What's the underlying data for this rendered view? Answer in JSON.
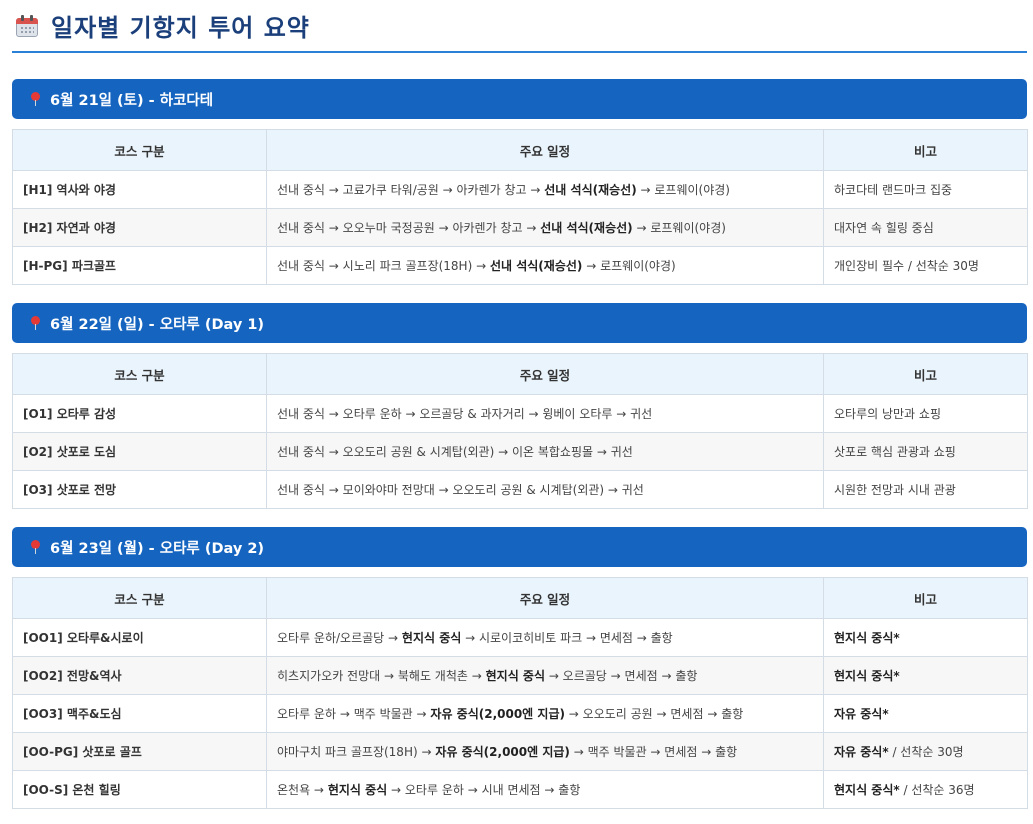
{
  "page": {
    "title": "일자별 기항지 투어 요약",
    "icon": "calendar-icon"
  },
  "columns": [
    "코스 구분",
    "주요 일정",
    "비고"
  ],
  "sections": [
    {
      "header": "6월 21일 (토) - 하코다테",
      "rows": [
        {
          "course": "[H1] 역사와 야경",
          "pre": "선내 중식 → 고료가쿠 타워/공원 → 아카렌가 창고 → ",
          "bold": "선내 석식(재승선)",
          "post": " → 로프웨이(야경)",
          "note_bold": "",
          "note": "하코다테 랜드마크 집중"
        },
        {
          "course": "[H2] 자연과 야경",
          "pre": "선내 중식 → 오오누마 국정공원 → 아카렌가 창고 → ",
          "bold": "선내 석식(재승선)",
          "post": " → 로프웨이(야경)",
          "note_bold": "",
          "note": "대자연 속 힐링 중심"
        },
        {
          "course": "[H-PG] 파크골프",
          "pre": "선내 중식 → 시노리 파크 골프장(18H) → ",
          "bold": "선내 석식(재승선)",
          "post": " → 로프웨이(야경)",
          "note_bold": "",
          "note": "개인장비 필수 / 선착순 30명"
        }
      ]
    },
    {
      "header": "6월 22일 (일) - 오타루 (Day 1)",
      "rows": [
        {
          "course": "[O1] 오타루 감성",
          "pre": "선내 중식 → 오타루 운하 → 오르골당 & 과자거리 → 윙베이 오타루 → 귀선",
          "bold": "",
          "post": "",
          "note_bold": "",
          "note": "오타루의 낭만과 쇼핑"
        },
        {
          "course": "[O2] 삿포로 도심",
          "pre": "선내 중식 → 오오도리 공원 & 시계탑(외관) → 이온 복합쇼핑몰 → 귀선",
          "bold": "",
          "post": "",
          "note_bold": "",
          "note": "삿포로 핵심 관광과 쇼핑"
        },
        {
          "course": "[O3] 삿포로 전망",
          "pre": "선내 중식 → 모이와야마 전망대 → 오오도리 공원 & 시계탑(외관) → 귀선",
          "bold": "",
          "post": "",
          "note_bold": "",
          "note": "시원한 전망과 시내 관광"
        }
      ]
    },
    {
      "header": "6월 23일 (월) - 오타루 (Day 2)",
      "rows": [
        {
          "course": "[OO1] 오타루&시로이",
          "pre": "오타루 운하/오르골당 → ",
          "bold": "현지식 중식",
          "post": " → 시로이코히비토 파크 → 면세점 → 출항",
          "note_bold": "현지식 중식*",
          "note": ""
        },
        {
          "course": "[OO2] 전망&역사",
          "pre": "히츠지가오카 전망대 → 북해도 개척촌 → ",
          "bold": "현지식 중식",
          "post": " → 오르골당 → 면세점 → 출항",
          "note_bold": "현지식 중식*",
          "note": ""
        },
        {
          "course": "[OO3] 맥주&도심",
          "pre": "오타루 운하 → 맥주 박물관 → ",
          "bold": "자유 중식(2,000엔 지급)",
          "post": " → 오오도리 공원 → 면세점 → 출항",
          "note_bold": "자유 중식*",
          "note": ""
        },
        {
          "course": "[OO-PG] 삿포로 골프",
          "pre": "야마구치 파크 골프장(18H) → ",
          "bold": "자유 중식(2,000엔 지급)",
          "post": " → 맥주 박물관 → 면세점 → 출항",
          "note_bold": "자유 중식*",
          "note": " / 선착순 30명"
        },
        {
          "course": "[OO-S] 온천 힐링",
          "pre": "온천욕 → ",
          "bold": "현지식 중식",
          "post": " → 오타루 운하 → 시내 면세점 → 출항",
          "note_bold": "현지식 중식*",
          "note": " / 선착순 36명"
        }
      ]
    }
  ]
}
